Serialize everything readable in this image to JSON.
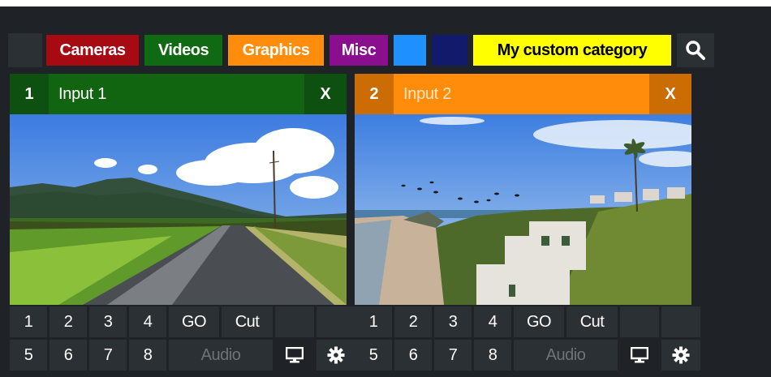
{
  "categories": [
    {
      "label": "",
      "color": "#2b3035"
    },
    {
      "label": "Cameras",
      "color": "#a80a14",
      "text": "#ffffff",
      "width": 118
    },
    {
      "label": "Videos",
      "color": "#0f6a13",
      "text": "#ffffff",
      "width": 100
    },
    {
      "label": "Graphics",
      "color": "#ff8c0a",
      "text": "#ffffff",
      "width": 122
    },
    {
      "label": "Misc",
      "color": "#8a0f8f",
      "text": "#ffffff",
      "width": 76
    },
    {
      "label": "",
      "color": "#1e90ff",
      "width": 44
    },
    {
      "label": "",
      "color": "#111a6b",
      "width": 48
    },
    {
      "label": "My custom category",
      "color": "#ffff00",
      "text": "#000000",
      "width": 248
    }
  ],
  "inputs": [
    {
      "number": "1",
      "title": "Input 1",
      "close": "X",
      "color": "#116410",
      "title_color": "#ffffff",
      "num_bg": "#0e5010",
      "close_bg": "#0e5010",
      "buttons_row1": [
        "1",
        "2",
        "3",
        "4",
        "GO",
        "Cut"
      ],
      "buttons_row2": [
        "5",
        "6",
        "7",
        "8"
      ],
      "audio_label": "Audio"
    },
    {
      "number": "2",
      "title": "Input 2",
      "close": "X",
      "color": "#ff8c0a",
      "title_color": "#ffe6c2",
      "num_bg": "#cc6d04",
      "close_bg": "#cc6d04",
      "buttons_row1": [
        "1",
        "2",
        "3",
        "4",
        "GO",
        "Cut"
      ],
      "buttons_row2": [
        "5",
        "6",
        "7",
        "8"
      ],
      "audio_label": "Audio"
    }
  ],
  "icons": {
    "search": "search-icon",
    "monitor": "monitor-icon",
    "settings": "gear-icon"
  }
}
